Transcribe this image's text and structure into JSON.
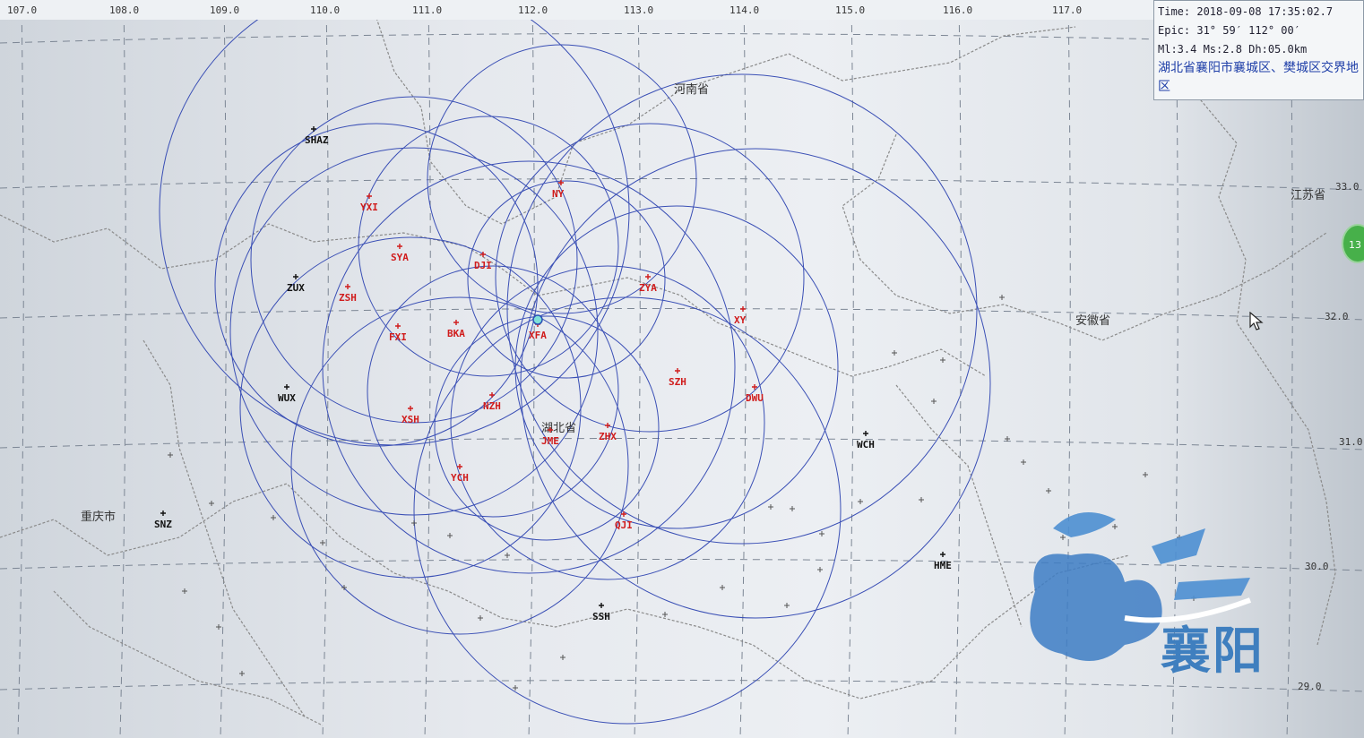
{
  "info_panel": {
    "time": "Time: 2018-09-08 17:35:02.7",
    "epic": "Epic: 31° 59′  112° 00′",
    "magnitudes": "Ml:3.4  Ms:2.8  Dh:05.0km",
    "location": "湖北省襄阳市襄城区、樊城区交界地区"
  },
  "top_axis_ticks": [
    "107.0",
    "108.0",
    "109.0",
    "110.0",
    "111.0",
    "112.0",
    "113.0",
    "114.0",
    "115.0",
    "116.0",
    "117.0"
  ],
  "right_axis_ticks": [
    "33.0",
    "32.0",
    "31.0",
    "30.0",
    "29.0"
  ],
  "stations_red": [
    "XFA",
    "NY",
    "YXI",
    "SYA",
    "DJI",
    "ZSH",
    "FXI",
    "BKA",
    "ZYA",
    "XY",
    "SZH",
    "DWU",
    "XSH",
    "NZH",
    "JME",
    "ZHX",
    "YCH",
    "QJI"
  ],
  "stations_black": [
    "SHAZ",
    "ZUX",
    "WUX",
    "SNZ",
    "WCH",
    "HME",
    "SSH"
  ],
  "region_labels": [
    "河南省",
    "江苏省",
    "安徽省",
    "湖北省",
    "重庆市"
  ],
  "badge": "13",
  "watermark": "襄阳",
  "colors": {
    "circle": "#3a4fb5",
    "station_red": "#d01c1c",
    "station_black": "#111111",
    "border": "#8a8a8a",
    "grid": "#7c8694"
  }
}
